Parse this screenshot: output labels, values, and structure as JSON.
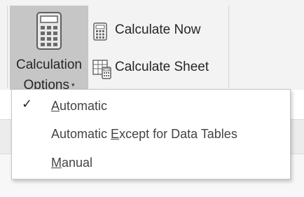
{
  "ribbon": {
    "calculation_options": {
      "line1": "Calculation",
      "line2": "Options",
      "caret": "▾",
      "icon": "calculator-icon"
    },
    "calculate_now": {
      "label": "Calculate Now",
      "icon": "calculator-small-icon"
    },
    "calculate_sheet": {
      "label": "Calculate Sheet",
      "icon": "calculate-sheet-icon"
    }
  },
  "menu": {
    "items": [
      {
        "pre": "",
        "access_key": "A",
        "post": "utomatic",
        "checked": true
      },
      {
        "pre": "Automatic ",
        "access_key": "E",
        "post": "xcept for Data Tables",
        "checked": false
      },
      {
        "pre": "",
        "access_key": "M",
        "post": "anual",
        "checked": false
      }
    ],
    "check_glyph": "✓"
  },
  "colors": {
    "ribbon_bg": "#f3f3f3",
    "selected_button_bg": "#c6c6c6",
    "menu_bg": "#ffffff",
    "menu_border": "#c6c6c6"
  }
}
